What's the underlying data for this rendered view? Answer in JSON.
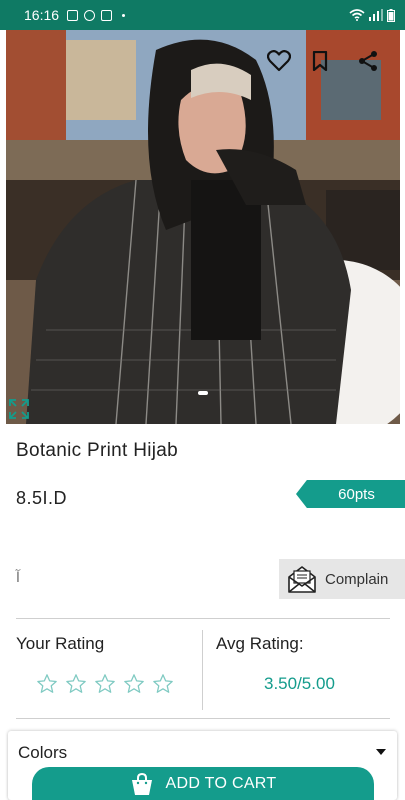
{
  "status_bar": {
    "time": "16:16"
  },
  "product": {
    "title": "Botanic Print Hijab",
    "price": "8.5I.D",
    "points": "60pts"
  },
  "actions": {
    "complain_label": "Complain",
    "arabic_mark": "آ"
  },
  "ratings": {
    "your_rating_label": "Your Rating",
    "your_rating_value": 0,
    "avg_rating_label": "Avg Rating:",
    "avg_rating_value": "3.50/5.00"
  },
  "colors_select": {
    "label": "Colors"
  },
  "cart": {
    "add_to_cart_label": "ADD TO CART"
  },
  "icons": {
    "wishlist": "heart-icon",
    "bookmark": "bookmark-icon",
    "share": "share-icon",
    "expand": "expand-icon",
    "complain": "envelope-icon",
    "cart": "shopping-bag-icon",
    "dropdown": "caret-down-icon"
  },
  "theme": {
    "accent": "#149c8c",
    "status_bar": "#0f7a64"
  }
}
